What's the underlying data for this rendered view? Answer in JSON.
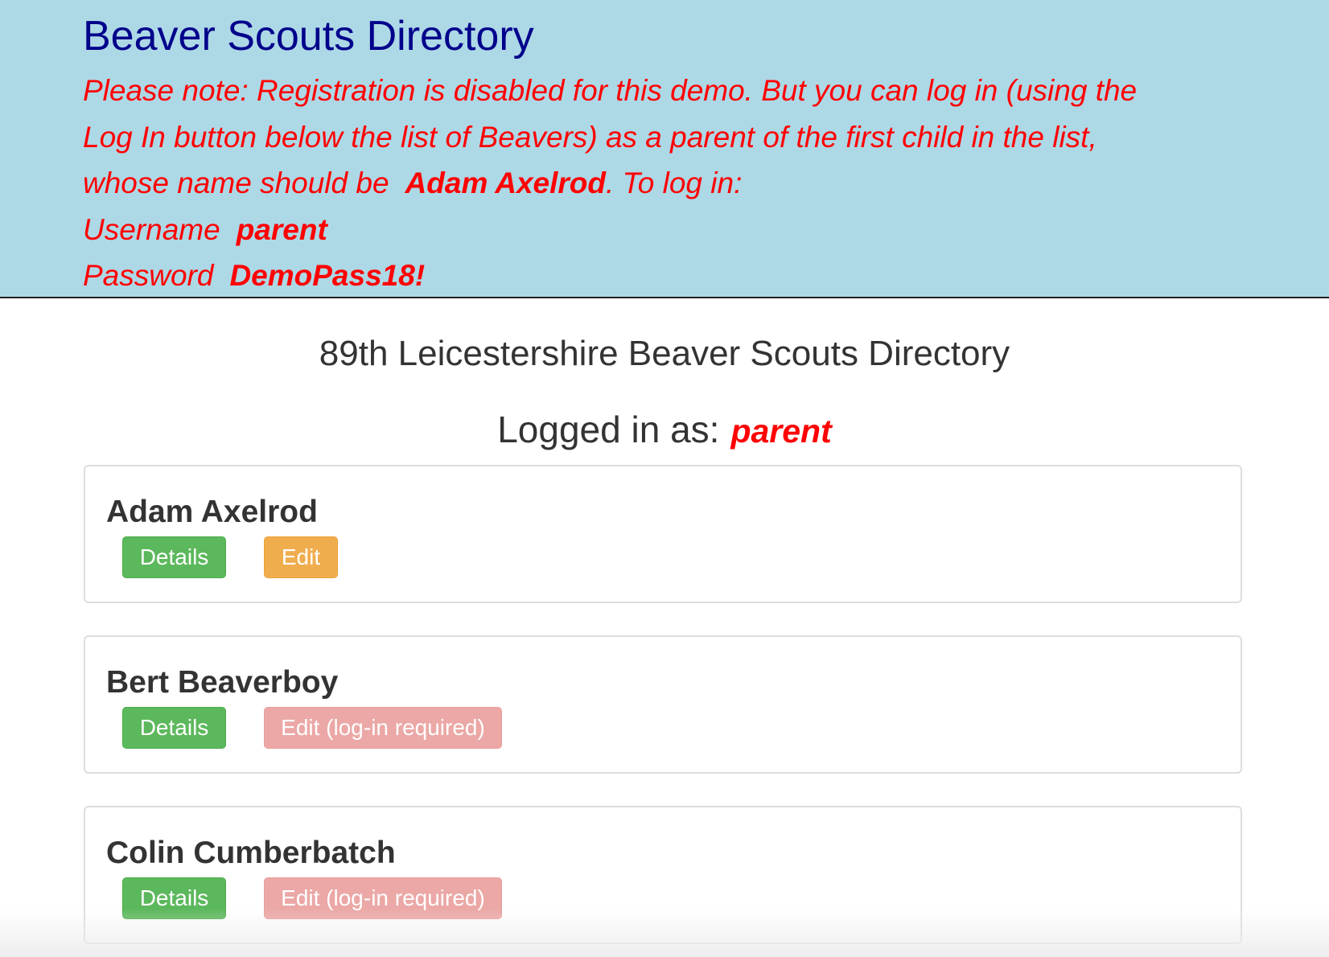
{
  "banner": {
    "title": "Beaver Scouts Directory",
    "notice_line1": "Please note: Registration is disabled for this demo. But you can log in (using the",
    "notice_line2": "Log In button below the list of Beavers) as a parent of the first child in the list,",
    "notice_line3_prefix": "whose name should be",
    "notice_line3_name": "Adam Axelrod",
    "notice_line3_suffix": ". To log in:",
    "username_label": "Username",
    "username_value": "parent",
    "password_label": "Password",
    "password_value": "DemoPass18!"
  },
  "main": {
    "title": "89th Leicestershire Beaver Scouts Directory",
    "logged_in_label": "Logged in as:",
    "logged_in_user": "parent"
  },
  "beavers": [
    {
      "name": "Adam Axelrod",
      "details_label": "Details",
      "edit_label": "Edit",
      "can_edit": true
    },
    {
      "name": "Bert Beaverboy",
      "details_label": "Details",
      "edit_label": "Edit (log-in required)",
      "can_edit": false
    },
    {
      "name": "Colin Cumberbatch",
      "details_label": "Details",
      "edit_label": "Edit (log-in required)",
      "can_edit": false
    }
  ],
  "colors": {
    "banner_bg": "#add8e6",
    "banner_title": "#00008b",
    "notice_text": "#ff0000",
    "details_button": "#5cb85c",
    "edit_button": "#f0ad4e",
    "edit_disabled_button": "#d9534f"
  }
}
